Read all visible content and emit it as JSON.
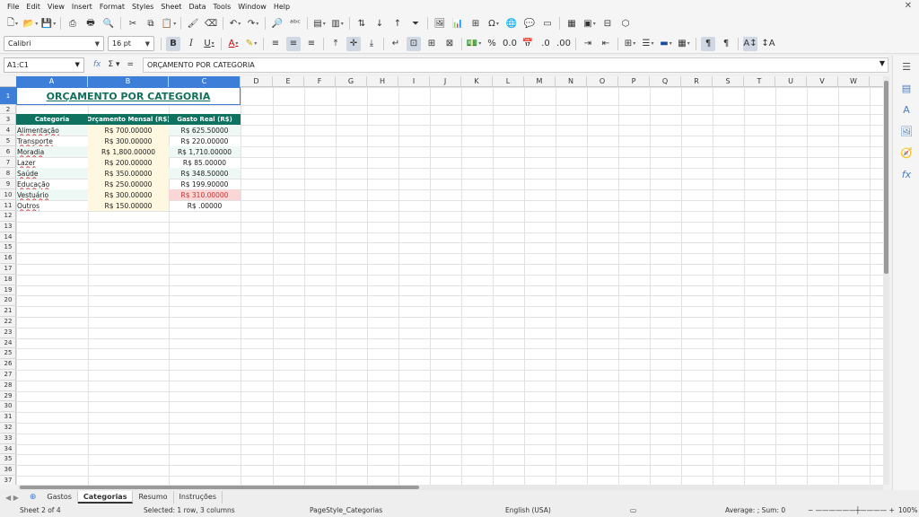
{
  "menu": [
    "File",
    "Edit",
    "View",
    "Insert",
    "Format",
    "Styles",
    "Sheet",
    "Data",
    "Tools",
    "Window",
    "Help"
  ],
  "toolbar": {
    "font_name": "Calibri",
    "font_size": "16 pt"
  },
  "formula": {
    "cell_ref": "A1:C1",
    "content": "ORÇAMENTO POR CATEGORIA"
  },
  "columns": [
    "A",
    "B",
    "C",
    "D",
    "E",
    "F",
    "G",
    "H",
    "I",
    "J",
    "K",
    "L",
    "M",
    "N",
    "O",
    "P",
    "Q",
    "R",
    "S",
    "T",
    "U",
    "V",
    "W"
  ],
  "sheet": {
    "title": "ORÇAMENTO POR CATEGORIA",
    "headers": [
      "Categoria",
      "Orçamento Mensal (R$)",
      "Gasto Real (R$)"
    ],
    "rows": [
      {
        "cat": "Alimentação",
        "budget": "R$ 700.00000",
        "spent": "R$ 625.50000",
        "over": false
      },
      {
        "cat": "Transporte",
        "budget": "R$ 300.00000",
        "spent": "R$ 220.00000",
        "over": false
      },
      {
        "cat": "Moradia",
        "budget": "R$ 1,800.00000",
        "spent": "R$ 1,710.00000",
        "over": false
      },
      {
        "cat": "Lazer",
        "budget": "R$ 200.00000",
        "spent": "R$ 85.00000",
        "over": false
      },
      {
        "cat": "Saúde",
        "budget": "R$ 350.00000",
        "spent": "R$ 348.50000",
        "over": false
      },
      {
        "cat": "Educação",
        "budget": "R$ 250.00000",
        "spent": "R$ 199.90000",
        "over": false
      },
      {
        "cat": "Vestuário",
        "budget": "R$ 300.00000",
        "spent": "R$ 310.00000",
        "over": true
      },
      {
        "cat": "Outros",
        "budget": "R$ 150.00000",
        "spent": "R$ .00000",
        "over": false
      }
    ]
  },
  "tabs": [
    "Gastos",
    "Categorias",
    "Resumo",
    "Instruções"
  ],
  "active_tab": "Categorias",
  "status": {
    "sheet": "Sheet 2 of 4",
    "selection": "Selected: 1 row, 3 columns",
    "page_style": "PageStyle_Categorias",
    "language": "English (USA)",
    "summary": "Average: ; Sum: 0",
    "zoom": "100%"
  },
  "colors": {
    "header_bg": "#0f7160",
    "title": "#12705a",
    "budget_bg": "#fff8e0",
    "over_bg": "#fbd6d6",
    "selection": "#3d7fd8"
  }
}
